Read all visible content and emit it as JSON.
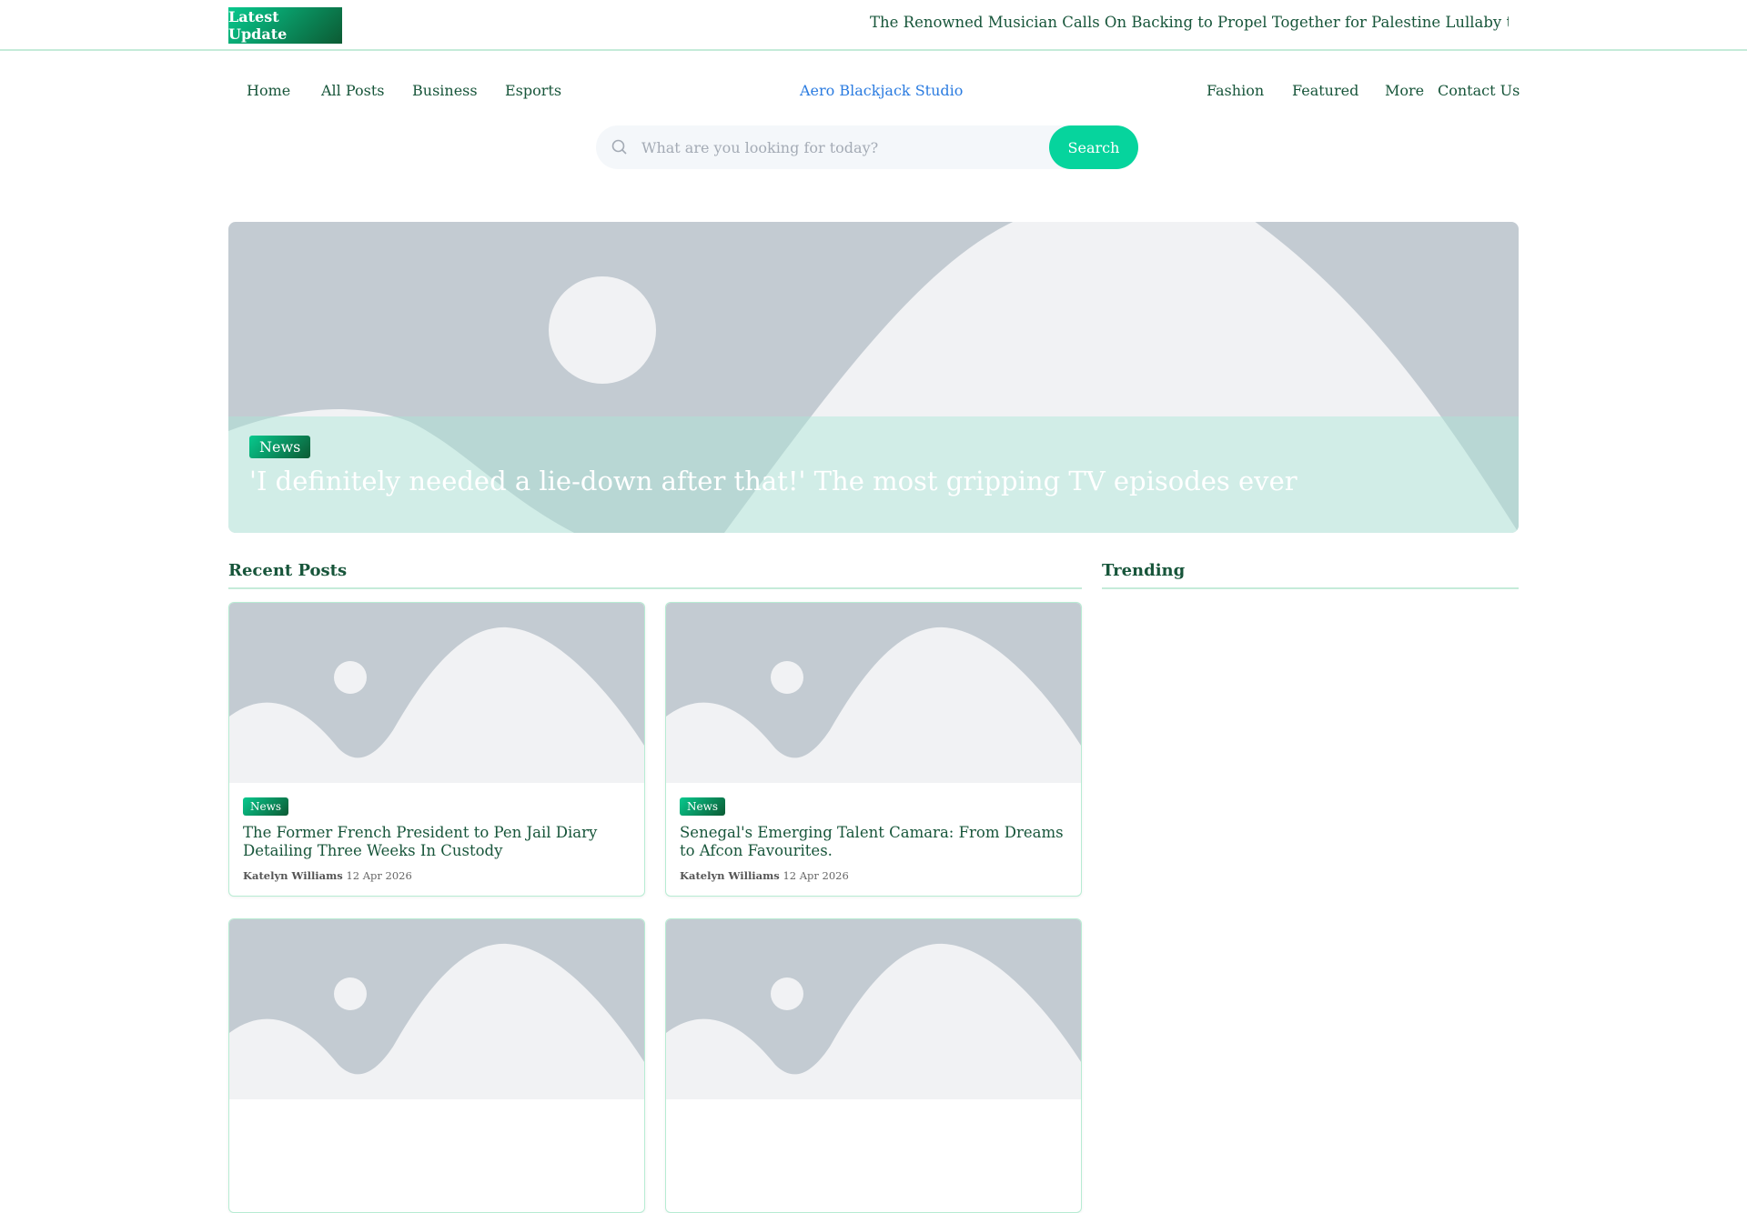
{
  "topbar": {
    "latest_label": "Latest  Update",
    "ticker": "The Renowned Musician Calls On Backing to Propel Together for Palestine Lullaby to UK Festival"
  },
  "nav": {
    "left": [
      "Home",
      "All Posts",
      "Business",
      "Esports"
    ],
    "brand": "Aero Blackjack Studio",
    "right": [
      "Fashion",
      "Featured",
      "More",
      "Contact Us"
    ]
  },
  "search": {
    "placeholder": "What are you looking for today?",
    "button": "Search"
  },
  "hero": {
    "category": "News",
    "title": "'I definitely needed a lie-down after that!' The most gripping TV episodes ever"
  },
  "sections": {
    "recent": "Recent Posts",
    "trending": "Trending"
  },
  "posts": [
    {
      "category": "News",
      "title": "The Former French President to Pen Jail Diary Detailing Three Weeks In Custody",
      "author": "Katelyn Williams",
      "date": "12 Apr 2026"
    },
    {
      "category": "News",
      "title": "Senegal's Emerging Talent Camara: From Dreams to Afcon Favourites.",
      "author": "Katelyn Williams",
      "date": "12 Apr 2026"
    }
  ]
}
